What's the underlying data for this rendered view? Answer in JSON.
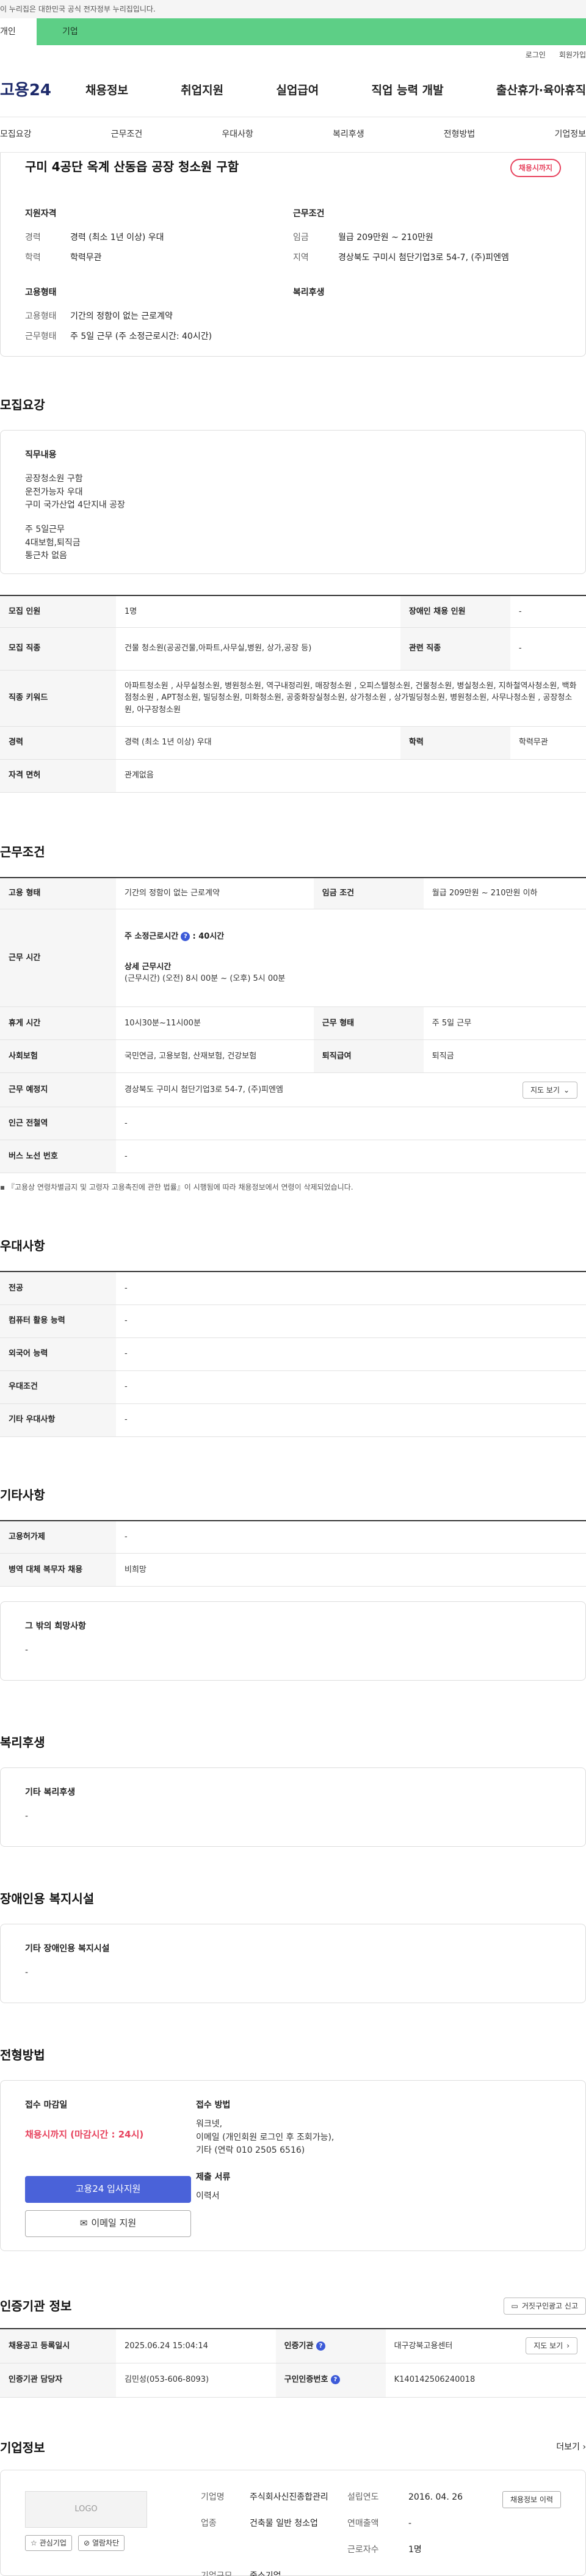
{
  "top_notice": "이 누리집은 대한민국 공식 전자정부 누리집입니다.",
  "tabs": {
    "personal": "개인",
    "company": "기업"
  },
  "util": {
    "login": "로그인",
    "signup": "회원가입"
  },
  "logo": "고용24",
  "gnb": [
    "채용정보",
    "취업지원",
    "실업급여",
    "직업 능력 개발",
    "출산휴가·육아휴직"
  ],
  "subnav": [
    "모집요강",
    "근무조건",
    "우대사항",
    "복리후생",
    "전형방법",
    "기업정보"
  ],
  "summary": {
    "title": "구미 4공단 옥계 산동읍 공장 청소원 구함",
    "badge": "채용시까지",
    "qual_title": "지원자격",
    "cond_title": "근무조건",
    "emp_title": "고용형태",
    "welfare_title": "복리후생",
    "qual": [
      {
        "k": "경력",
        "v": "경력 (최소 1년 이상) 우대"
      },
      {
        "k": "학력",
        "v": "학력무관"
      }
    ],
    "cond": [
      {
        "k": "임금",
        "v": "월급 209만원 ~ 210만원"
      },
      {
        "k": "지역",
        "v": "경상북도 구미시 첨단기업3로 54-7, (주)피엔엠"
      }
    ],
    "emp": [
      {
        "k": "고용형태",
        "v": "기간의 정함이 없는 근로계약"
      },
      {
        "k": "근무형태",
        "v": "주 5일 근무 (주 소정근로시간: 40시간)"
      }
    ]
  },
  "recruit": {
    "title": "모집요강",
    "duty_label": "직무내용",
    "duty_lines": [
      "공장청소원 구함",
      "운전가능자 우대",
      "구미 국가산업 4단지내 공장",
      "",
      "주 5일근무",
      "4대보험,퇴직금",
      "통근차 없음"
    ],
    "rows": [
      {
        "k": "모집 인원",
        "v": "1명",
        "k2": "장애인 채용 인원",
        "v2": "-"
      },
      {
        "k": "모집 직종",
        "v": "건물 청소원(공공건물,아파트,사무실,병원, 상가,공장 등)",
        "k2": "관련 직종",
        "v2": "-"
      },
      {
        "k": "직종 키워드",
        "v": "아파트청소원 , 사무실청소원, 병원청소원, 역구내정리원, 매장청소원 , 오피스텔청소원, 건물청소원, 병실청소원, 지하철역사청소원, 백화점청소원 , APT청소원, 빌딩청소원, 미화청소원, 공중화장실청소원, 상가청소원 , 상가빌딩청소원, 병원청소원, 사무나청소원 , 공장청소원, 아구장청소원"
      },
      {
        "k": "경력",
        "v": "경력 (최소 1년 이상) 우대",
        "k2": "학력",
        "v2": "학력무관"
      },
      {
        "k": "자격 면허",
        "v": "관계없음"
      }
    ]
  },
  "work": {
    "title": "근무조건",
    "emp_type_k": "고용 형태",
    "emp_type_v": "기간의 정함이 없는 근로계약",
    "wage_k": "임금 조건",
    "wage_v": "월급 209만원 ~ 210만원 이하",
    "hours_k": "근무 시간",
    "hours_weekly": "주 소정근로시간",
    "hours_weekly_v": ": 40시간",
    "hours_detail_label": "상세 근무시간",
    "hours_detail_v": "(근무시간) (오전) 8시 00분 ~ (오후) 5시 00분",
    "rest_k": "휴게 시간",
    "rest_v": "10시30분~11시00분",
    "form_k": "근무 형태",
    "form_v": "주 5일 근무",
    "ins_k": "사회보험",
    "ins_v": "국민연금, 고용보험, 산재보험, 건강보험",
    "sev_k": "퇴직급여",
    "sev_v": "퇴직금",
    "place_k": "근무 예정지",
    "place_v": "경상북도 구미시 첨단기업3로 54-7, (주)피엔엠",
    "map_btn": "지도 보기",
    "subway_k": "인근 전철역",
    "subway_v": "-",
    "bus_k": "버스 노선 번호",
    "bus_v": "-",
    "note": "『고용상 연령차별금지 및 고령자 고용촉진에 관한 법률』이 시행됨에 따라 채용정보에서 연령이 삭제되었습니다."
  },
  "pref": {
    "title": "우대사항",
    "rows": [
      {
        "k": "전공",
        "v": "-"
      },
      {
        "k": "컴퓨터 활용 능력",
        "v": "-"
      },
      {
        "k": "외국어 능력",
        "v": "-"
      },
      {
        "k": "우대조건",
        "v": "-"
      },
      {
        "k": "기타 우대사항",
        "v": "-"
      }
    ]
  },
  "etc": {
    "title": "기타사항",
    "rows": [
      {
        "k": "고용허가제",
        "v": "-"
      },
      {
        "k": "병역 대체 복무자 채용",
        "v": "비희망"
      }
    ],
    "extra_label": "그 밖의 희망사항",
    "extra_v": "-"
  },
  "welfare": {
    "title": "복리후생",
    "label": "기타 복리후생",
    "v": "-"
  },
  "disab": {
    "title": "장애인용 복지시설",
    "label": "기타 장애인용 복지시설",
    "v": "-"
  },
  "method": {
    "title": "전형방법",
    "deadline_label": "접수 마감일",
    "deadline_v": "채용시까지 (마감시간 : 24시)",
    "apply_btn": "고용24 입사지원",
    "email_btn": "이메일 지원",
    "recv_label": "접수 방법",
    "recv_lines": [
      "워크넷,",
      "이메일 (개인회원 로그인 후 조회가능),",
      "기타 (연락 010 2505 6516)"
    ],
    "docs_label": "제출 서류",
    "docs_v": "이력서"
  },
  "cert": {
    "title": "인증기관 정보",
    "report_btn": "거짓구인광고 신고",
    "reg_k": "채용공고 등록일시",
    "reg_v": "2025.06.24 15:04:14",
    "org_k": "인증기관",
    "org_v": "대구강북고용센터",
    "map_btn": "지도 보기",
    "mgr_k": "인증기관 담당자",
    "mgr_v": "김민성(053-606-8093)",
    "num_k": "구인인증번호",
    "num_v": "K140142506240018"
  },
  "company": {
    "title": "기업정보",
    "more": "더보기",
    "logo": "LOGO",
    "fav_btn": "관심기업",
    "block_btn": "열람차단",
    "info": [
      {
        "k": "기업명",
        "v": "주식회사신진종합관리"
      },
      {
        "k": "설립연도",
        "v": "2016. 04. 26"
      },
      {
        "k": "업종",
        "v": "건축물 일반 청소업"
      },
      {
        "k": "연매출액",
        "v": "-"
      },
      {
        "k": "",
        "v": ""
      },
      {
        "k": "근로자수",
        "v": "1명"
      },
      {
        "k": "기업규모",
        "v": "중소기업"
      },
      {
        "k": "",
        "v": ""
      }
    ],
    "detail_btn": "채용정보 이력"
  }
}
